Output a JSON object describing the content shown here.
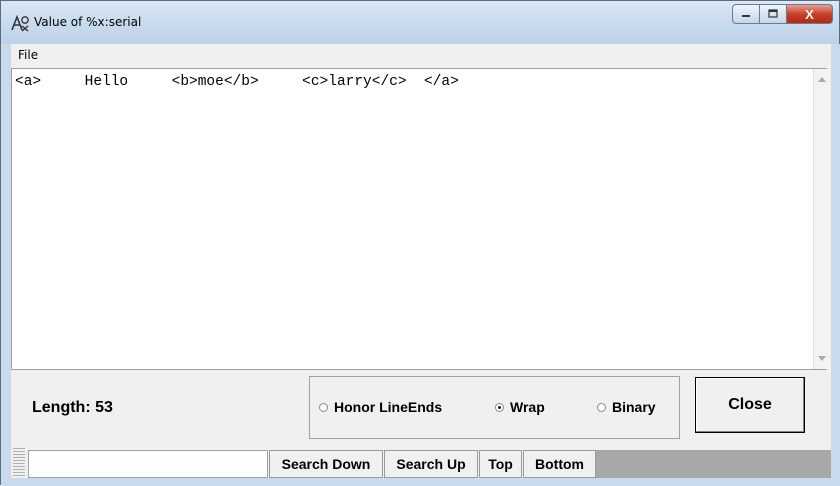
{
  "window": {
    "title": "Value of %x:serial",
    "close_glyph": "X"
  },
  "menu": {
    "file_label": "File"
  },
  "content": {
    "text": "<a>     Hello     <b>moe</b>     <c>larry</c>  </a>"
  },
  "status": {
    "length_label": "Length:  53"
  },
  "options": {
    "honor_lineends_label": "Honor LineEnds",
    "wrap_label": "Wrap",
    "binary_label": "Binary",
    "selected": "Wrap"
  },
  "buttons": {
    "close_label": "Close",
    "search_down_label": "Search Down",
    "search_up_label": "Search Up",
    "top_label": "Top",
    "bottom_label": "Bottom"
  },
  "search": {
    "value": ""
  }
}
